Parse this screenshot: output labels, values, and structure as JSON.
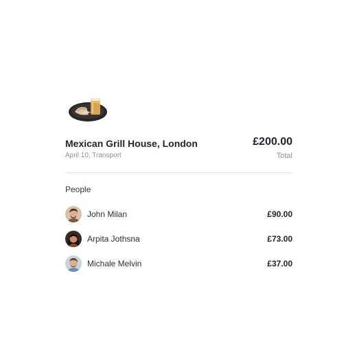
{
  "expense": {
    "image_icon": "food-plate-image",
    "merchant": "Mexican Grill House, London",
    "meta": "April 10, Transport",
    "total_amount": "£200.00",
    "total_label": "Total"
  },
  "people": {
    "title": "People",
    "items": [
      {
        "name": "John Milan",
        "amount": "£90.00",
        "avatar_icon": "avatar-john-milan"
      },
      {
        "name": "Arpita Jothsna",
        "amount": "£73.00",
        "avatar_icon": "avatar-arpita-jothsna"
      },
      {
        "name": "Michale Melvin",
        "amount": "£37.00",
        "avatar_icon": "avatar-michale-melvin"
      }
    ]
  }
}
